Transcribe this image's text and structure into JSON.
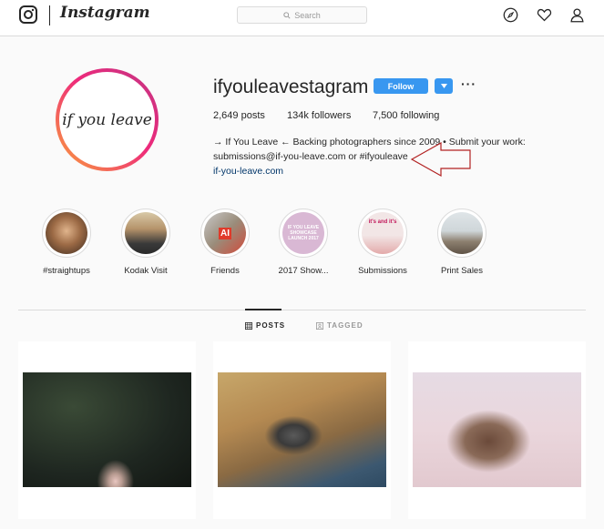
{
  "header": {
    "wordmark": "Instagram",
    "search_placeholder": "Search",
    "icons": [
      "instagram-logo-icon",
      "compass-icon",
      "heart-icon",
      "person-icon"
    ]
  },
  "profile": {
    "avatar_text": "if you leave",
    "username": "ifyouleavestagram",
    "follow_label": "Follow",
    "more_label": "···",
    "stats": {
      "posts": "2,649 posts",
      "followers": "134k followers",
      "following": "7,500 following"
    },
    "bio_line1": "→ If You Leave ← Backing photographers since 2009 • Submit your work:",
    "bio_line2": "submissions@if-you-leave.com or #ifyouleave",
    "link": "if-you-leave.com"
  },
  "highlights": [
    {
      "label": "#straightups"
    },
    {
      "label": "Kodak Visit"
    },
    {
      "label": "Friends"
    },
    {
      "label": "2017 Show..."
    },
    {
      "label": "Submissions"
    },
    {
      "label": "Print Sales"
    }
  ],
  "highlight_thumb_text": {
    "friends": "AI",
    "show": "IF YOU LEAVE SHOWCASE LAUNCH 2017",
    "submissions": "it's and it's"
  },
  "tabs": {
    "posts": "POSTS",
    "tagged": "TAGGED"
  },
  "colors": {
    "accent": "#3897f0",
    "link": "#003569",
    "annotation": "#b22222"
  }
}
